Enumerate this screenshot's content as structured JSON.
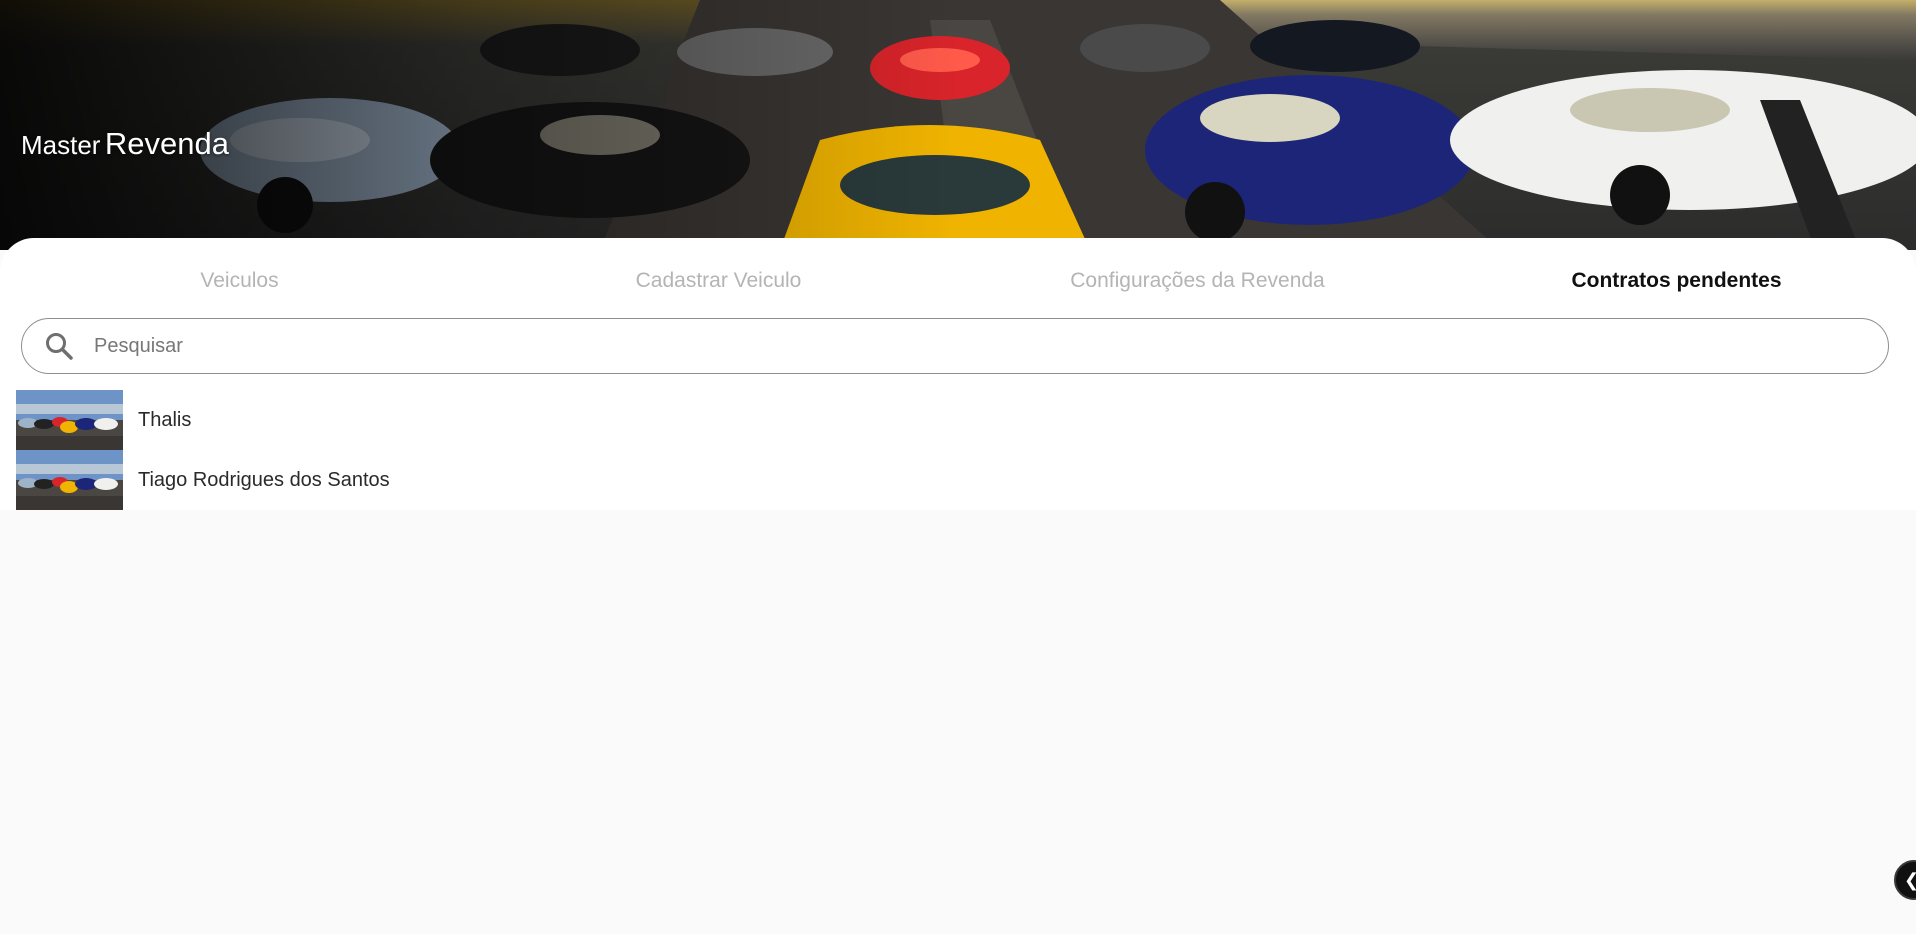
{
  "header": {
    "brand_small": "Master",
    "brand_large": "Revenda",
    "banner_image": "supercars-on-runway"
  },
  "tabs": [
    {
      "label": "Veiculos",
      "active": false
    },
    {
      "label": "Cadastrar Veiculo",
      "active": false
    },
    {
      "label": "Configurações da Revenda",
      "active": false
    },
    {
      "label": "Contratos pendentes",
      "active": true
    }
  ],
  "search": {
    "placeholder": "Pesquisar",
    "value": "",
    "icon": "search-icon"
  },
  "contracts": [
    {
      "name": "Thalis",
      "thumbnail": "supercars-thumbnail"
    },
    {
      "name": "Tiago Rodrigues dos Santos",
      "thumbnail": "supercars-thumbnail"
    }
  ],
  "fab": {
    "icon": "chevron-left-icon"
  },
  "colors": {
    "background": "#fafafa",
    "sheet": "#ffffff",
    "tab_inactive": "#b4b4b4",
    "tab_active": "#111111",
    "search_border": "#8e8e8e",
    "fab": "#111111"
  }
}
